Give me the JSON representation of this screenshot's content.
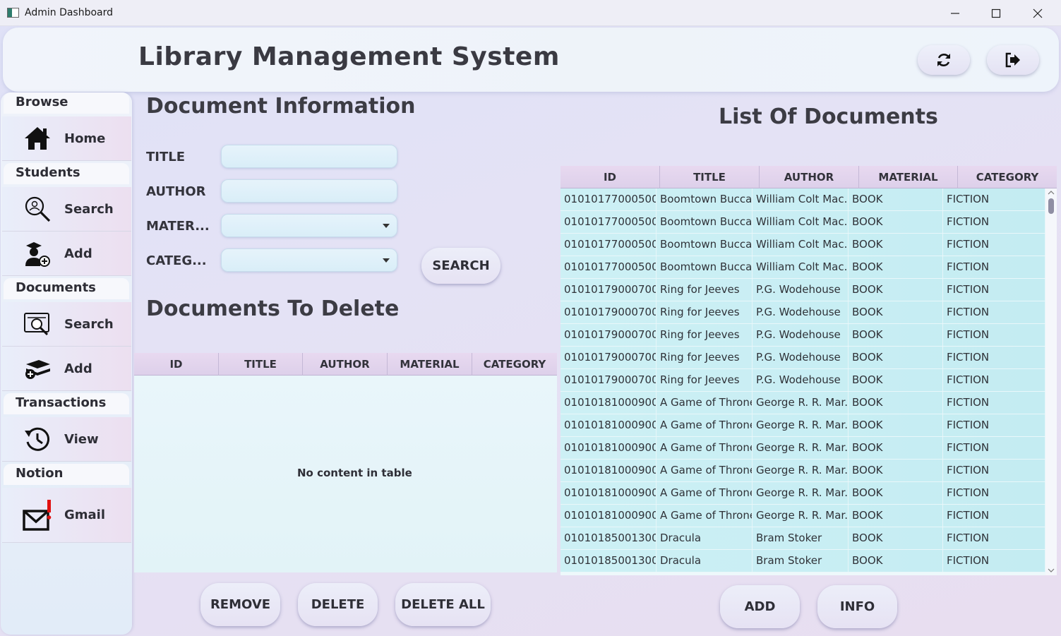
{
  "window": {
    "title": "Admin Dashboard",
    "minimize": "—",
    "maximize": "☐",
    "close": "✕"
  },
  "header": {
    "app_title": "Library Management System",
    "refresh_icon": "refresh-icon",
    "logout_icon": "logout-icon"
  },
  "sidebar": {
    "sections": {
      "browse": "Browse",
      "students": "Students",
      "documents": "Documents",
      "transactions": "Transactions",
      "notion": "Notion"
    },
    "items": {
      "home": "Home",
      "student_search": "Search",
      "student_add": "Add",
      "document_search": "Search",
      "document_add": "Add",
      "transactions_view": "View",
      "gmail": "Gmail"
    }
  },
  "doc_info": {
    "title": "Document Information",
    "labels": {
      "title": "TITLE",
      "author": "AUTHOR",
      "material": "MATER...",
      "category": "CATEG..."
    },
    "values": {
      "title": "",
      "author": "",
      "material": "",
      "category": ""
    },
    "search_button": "SEARCH"
  },
  "delete_section": {
    "title": "Documents To Delete",
    "columns": [
      "ID",
      "TITLE",
      "AUTHOR",
      "MATERIAL",
      "CATEGORY"
    ],
    "empty_message": "No content in table",
    "buttons": {
      "remove": "REMOVE",
      "delete": "DELETE",
      "delete_all": "DELETE ALL"
    }
  },
  "list_section": {
    "title": "List Of Documents",
    "columns": [
      "ID",
      "TITLE",
      "AUTHOR",
      "MATERIAL",
      "CATEGORY"
    ],
    "rows": [
      [
        "01010177000500...",
        "Boomtown Bucca...",
        "William Colt Mac...",
        "BOOK",
        "FICTION"
      ],
      [
        "01010177000500...",
        "Boomtown Bucca...",
        "William Colt Mac...",
        "BOOK",
        "FICTION"
      ],
      [
        "01010177000500...",
        "Boomtown Bucca...",
        "William Colt Mac...",
        "BOOK",
        "FICTION"
      ],
      [
        "01010177000500...",
        "Boomtown Bucca...",
        "William Colt Mac...",
        "BOOK",
        "FICTION"
      ],
      [
        "01010179000700...",
        "Ring for Jeeves",
        "P.G. Wodehouse",
        "BOOK",
        "FICTION"
      ],
      [
        "01010179000700...",
        "Ring for Jeeves",
        "P.G. Wodehouse",
        "BOOK",
        "FICTION"
      ],
      [
        "01010179000700...",
        "Ring for Jeeves",
        "P.G. Wodehouse",
        "BOOK",
        "FICTION"
      ],
      [
        "01010179000700...",
        "Ring for Jeeves",
        "P.G. Wodehouse",
        "BOOK",
        "FICTION"
      ],
      [
        "01010179000700...",
        "Ring for Jeeves",
        "P.G. Wodehouse",
        "BOOK",
        "FICTION"
      ],
      [
        "01010181000900...",
        "A Game of Thrones",
        "George R. R. Mar...",
        "BOOK",
        "FICTION"
      ],
      [
        "01010181000900...",
        "A Game of Thrones",
        "George R. R. Mar...",
        "BOOK",
        "FICTION"
      ],
      [
        "01010181000900...",
        "A Game of Thrones",
        "George R. R. Mar...",
        "BOOK",
        "FICTION"
      ],
      [
        "01010181000900...",
        "A Game of Thrones",
        "George R. R. Mar...",
        "BOOK",
        "FICTION"
      ],
      [
        "01010181000900...",
        "A Game of Thrones",
        "George R. R. Mar...",
        "BOOK",
        "FICTION"
      ],
      [
        "01010181000900...",
        "A Game of Thrones",
        "George R. R. Mar...",
        "BOOK",
        "FICTION"
      ],
      [
        "01010185001300...",
        "Dracula",
        "Bram Stoker",
        "BOOK",
        "FICTION"
      ],
      [
        "01010185001300...",
        "Dracula",
        "Bram Stoker",
        "BOOK",
        "FICTION"
      ]
    ],
    "buttons": {
      "add": "ADD",
      "info": "INFO"
    }
  }
}
